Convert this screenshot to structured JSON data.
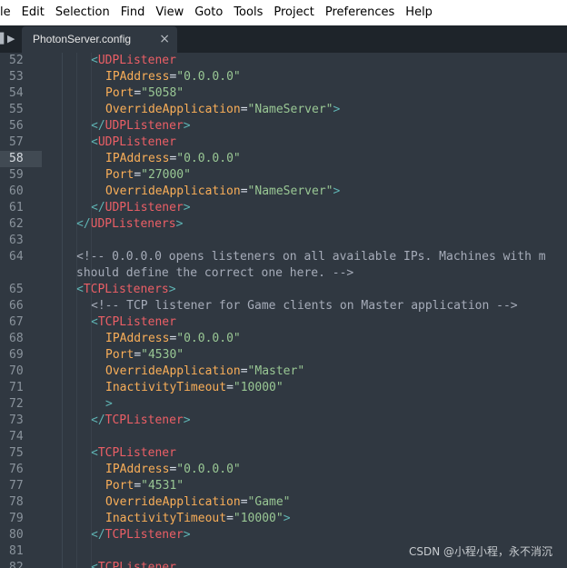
{
  "menubar": {
    "items": [
      "le",
      "Edit",
      "Selection",
      "Find",
      "View",
      "Goto",
      "Tools",
      "Project",
      "Preferences",
      "Help"
    ]
  },
  "tab": {
    "label": "PhotonServer.config",
    "close_symbol": "×"
  },
  "editor": {
    "active_line": 58,
    "lines": [
      {
        "n": "52",
        "indent": 1,
        "tokens": [
          [
            "punct",
            "<"
          ],
          [
            "tag",
            "UDPListener"
          ]
        ]
      },
      {
        "n": "53",
        "indent": 2,
        "tokens": [
          [
            "attr",
            "IPAddress"
          ],
          [
            "eq",
            "="
          ],
          [
            "str",
            "\"0.0.0.0\""
          ]
        ]
      },
      {
        "n": "54",
        "indent": 2,
        "tokens": [
          [
            "attr",
            "Port"
          ],
          [
            "eq",
            "="
          ],
          [
            "str",
            "\"5058\""
          ]
        ]
      },
      {
        "n": "55",
        "indent": 2,
        "tokens": [
          [
            "attr",
            "OverrideApplication"
          ],
          [
            "eq",
            "="
          ],
          [
            "str",
            "\"NameServer\""
          ],
          [
            "punct",
            ">"
          ]
        ]
      },
      {
        "n": "56",
        "indent": 1,
        "tokens": [
          [
            "punct",
            "</"
          ],
          [
            "tag",
            "UDPListener"
          ],
          [
            "punct",
            ">"
          ]
        ]
      },
      {
        "n": "57",
        "indent": 1,
        "tokens": [
          [
            "punct",
            "<"
          ],
          [
            "tag",
            "UDPListener"
          ]
        ]
      },
      {
        "n": "58",
        "indent": 2,
        "tokens": [
          [
            "attr",
            "IPAddress"
          ],
          [
            "eq",
            "="
          ],
          [
            "str",
            "\"0.0.0.0\""
          ]
        ]
      },
      {
        "n": "59",
        "indent": 2,
        "tokens": [
          [
            "attr",
            "Port"
          ],
          [
            "eq",
            "="
          ],
          [
            "str",
            "\"27000\""
          ]
        ]
      },
      {
        "n": "60",
        "indent": 2,
        "tokens": [
          [
            "attr",
            "OverrideApplication"
          ],
          [
            "eq",
            "="
          ],
          [
            "str",
            "\"NameServer\""
          ],
          [
            "punct",
            ">"
          ]
        ]
      },
      {
        "n": "61",
        "indent": 1,
        "tokens": [
          [
            "punct",
            "</"
          ],
          [
            "tag",
            "UDPListener"
          ],
          [
            "punct",
            ">"
          ]
        ]
      },
      {
        "n": "62",
        "indent": 0,
        "tokens": [
          [
            "punct",
            "</"
          ],
          [
            "tag",
            "UDPListeners"
          ],
          [
            "punct",
            ">"
          ]
        ]
      },
      {
        "n": "63",
        "indent": 0,
        "tokens": []
      },
      {
        "n": "64",
        "indent": 0,
        "tokens": [
          [
            "comment",
            "<!-- 0.0.0.0 opens listeners on all available IPs. Machines with m"
          ]
        ]
      },
      {
        "n": "",
        "indent": 0,
        "tokens": [
          [
            "comment",
            "should define the correct one here. -->"
          ]
        ]
      },
      {
        "n": "65",
        "indent": 0,
        "tokens": [
          [
            "punct",
            "<"
          ],
          [
            "tag",
            "TCPListeners"
          ],
          [
            "punct",
            ">"
          ]
        ]
      },
      {
        "n": "66",
        "indent": 1,
        "tokens": [
          [
            "comment",
            "<!-- TCP listener for Game clients on Master application -->"
          ]
        ]
      },
      {
        "n": "67",
        "indent": 1,
        "tokens": [
          [
            "punct",
            "<"
          ],
          [
            "tag",
            "TCPListener"
          ]
        ]
      },
      {
        "n": "68",
        "indent": 2,
        "tokens": [
          [
            "attr",
            "IPAddress"
          ],
          [
            "eq",
            "="
          ],
          [
            "str",
            "\"0.0.0.0\""
          ]
        ]
      },
      {
        "n": "69",
        "indent": 2,
        "tokens": [
          [
            "attr",
            "Port"
          ],
          [
            "eq",
            "="
          ],
          [
            "str",
            "\"4530\""
          ]
        ]
      },
      {
        "n": "70",
        "indent": 2,
        "tokens": [
          [
            "attr",
            "OverrideApplication"
          ],
          [
            "eq",
            "="
          ],
          [
            "str",
            "\"Master\""
          ]
        ]
      },
      {
        "n": "71",
        "indent": 2,
        "tokens": [
          [
            "attr",
            "InactivityTimeout"
          ],
          [
            "eq",
            "="
          ],
          [
            "str",
            "\"10000\""
          ]
        ]
      },
      {
        "n": "72",
        "indent": 2,
        "tokens": [
          [
            "punct",
            ">"
          ]
        ]
      },
      {
        "n": "73",
        "indent": 1,
        "tokens": [
          [
            "punct",
            "</"
          ],
          [
            "tag",
            "TCPListener"
          ],
          [
            "punct",
            ">"
          ]
        ]
      },
      {
        "n": "74",
        "indent": 0,
        "tokens": []
      },
      {
        "n": "75",
        "indent": 1,
        "tokens": [
          [
            "punct",
            "<"
          ],
          [
            "tag",
            "TCPListener"
          ]
        ]
      },
      {
        "n": "76",
        "indent": 2,
        "tokens": [
          [
            "attr",
            "IPAddress"
          ],
          [
            "eq",
            "="
          ],
          [
            "str",
            "\"0.0.0.0\""
          ]
        ]
      },
      {
        "n": "77",
        "indent": 2,
        "tokens": [
          [
            "attr",
            "Port"
          ],
          [
            "eq",
            "="
          ],
          [
            "str",
            "\"4531\""
          ]
        ]
      },
      {
        "n": "78",
        "indent": 2,
        "tokens": [
          [
            "attr",
            "OverrideApplication"
          ],
          [
            "eq",
            "="
          ],
          [
            "str",
            "\"Game\""
          ]
        ]
      },
      {
        "n": "79",
        "indent": 2,
        "tokens": [
          [
            "attr",
            "InactivityTimeout"
          ],
          [
            "eq",
            "="
          ],
          [
            "str",
            "\"10000\""
          ],
          [
            "punct",
            ">"
          ]
        ]
      },
      {
        "n": "80",
        "indent": 1,
        "tokens": [
          [
            "punct",
            "</"
          ],
          [
            "tag",
            "TCPListener"
          ],
          [
            "punct",
            ">"
          ]
        ]
      },
      {
        "n": "81",
        "indent": 0,
        "tokens": []
      },
      {
        "n": "82",
        "indent": 1,
        "tokens": [
          [
            "punct",
            "<"
          ],
          [
            "tag",
            "TCPListener"
          ]
        ]
      }
    ]
  },
  "watermark": "CSDN @小程小程，永不消沉",
  "colors": {
    "background": "#303841",
    "tag": "#ec5f66",
    "attribute": "#f9ae58",
    "string": "#99c794",
    "punctuation": "#5fb4b4",
    "comment": "#a6acb9"
  },
  "icons": {
    "tab_scroll": "triangle-right-icon"
  }
}
